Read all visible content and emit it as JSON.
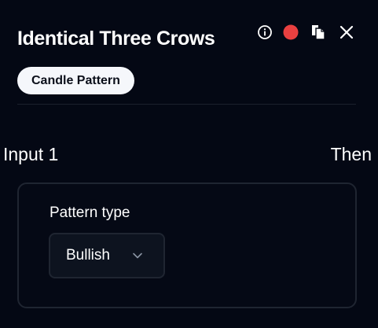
{
  "header": {
    "title": "Identical Three Crows",
    "tag": "Candle Pattern",
    "icons": {
      "info": "info-icon",
      "record": "record-icon",
      "copy": "copy-icon",
      "close": "close-icon"
    },
    "record_color": "#e94040"
  },
  "flow": {
    "input_label": "Input 1",
    "then_label": "Then"
  },
  "card": {
    "field_label": "Pattern type",
    "select_value": "Bullish"
  }
}
